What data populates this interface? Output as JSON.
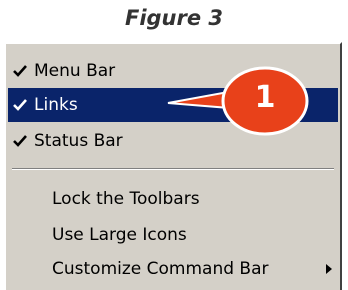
{
  "figure": {
    "title": "Figure 3"
  },
  "menu": {
    "items": [
      {
        "label": "Menu Bar",
        "checked": true,
        "selected": false
      },
      {
        "label": "Links",
        "checked": true,
        "selected": true
      },
      {
        "label": "Status Bar",
        "checked": true,
        "selected": false
      },
      {
        "label": "Lock the Toolbars",
        "checked": false,
        "selected": false
      },
      {
        "label": "Use Large Icons",
        "checked": false,
        "selected": false
      },
      {
        "label": "Customize Command Bar",
        "checked": false,
        "selected": false,
        "submenu": true
      }
    ]
  },
  "callout": {
    "number": "1",
    "color": "#e8411a"
  },
  "colors": {
    "menu_bg": "#d4d0c8",
    "highlight": "#0a246a"
  }
}
